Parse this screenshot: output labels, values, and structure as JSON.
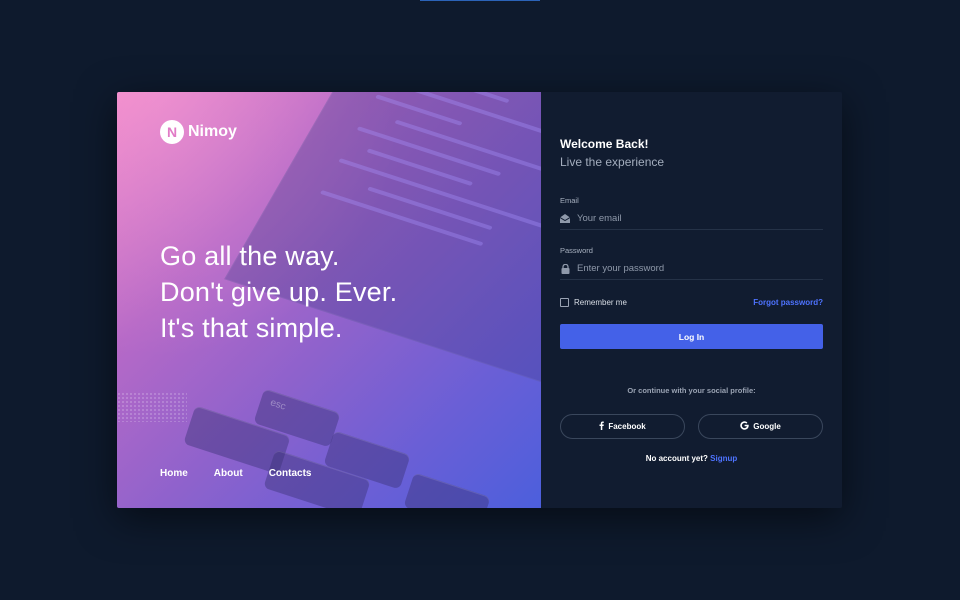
{
  "brand": {
    "initial": "N",
    "name": "Nimoy"
  },
  "hero": {
    "tagline": [
      "Go all the way.",
      "Don't give up. Ever.",
      "It's that simple."
    ],
    "nav": [
      "Home",
      "About",
      "Contacts"
    ],
    "keys": [
      "esc"
    ]
  },
  "form": {
    "welcome_title": "Welcome Back!",
    "welcome_subtitle": "Live the experience",
    "email_label": "Email",
    "email_placeholder": "Your email",
    "password_label": "Password",
    "password_placeholder": "Enter your password",
    "remember_label": "Remember me",
    "forgot_label": "Forgot password?",
    "login_label": "Log In",
    "social_note": "Or continue with your social profile:",
    "facebook_label": "Facebook",
    "google_label": "Google",
    "signup_prompt": "No account yet?",
    "signup_label": "Signup"
  },
  "icons": {
    "email": "envelope-icon",
    "password": "lock-icon",
    "facebook": "facebook-icon",
    "google": "google-icon"
  },
  "colors": {
    "background": "#0e1a2d",
    "panel": "#111c30",
    "accent": "#4461e8",
    "link": "#4e73ff",
    "gradient_start": "#ee86c8",
    "gradient_end": "#4c5fdc"
  }
}
